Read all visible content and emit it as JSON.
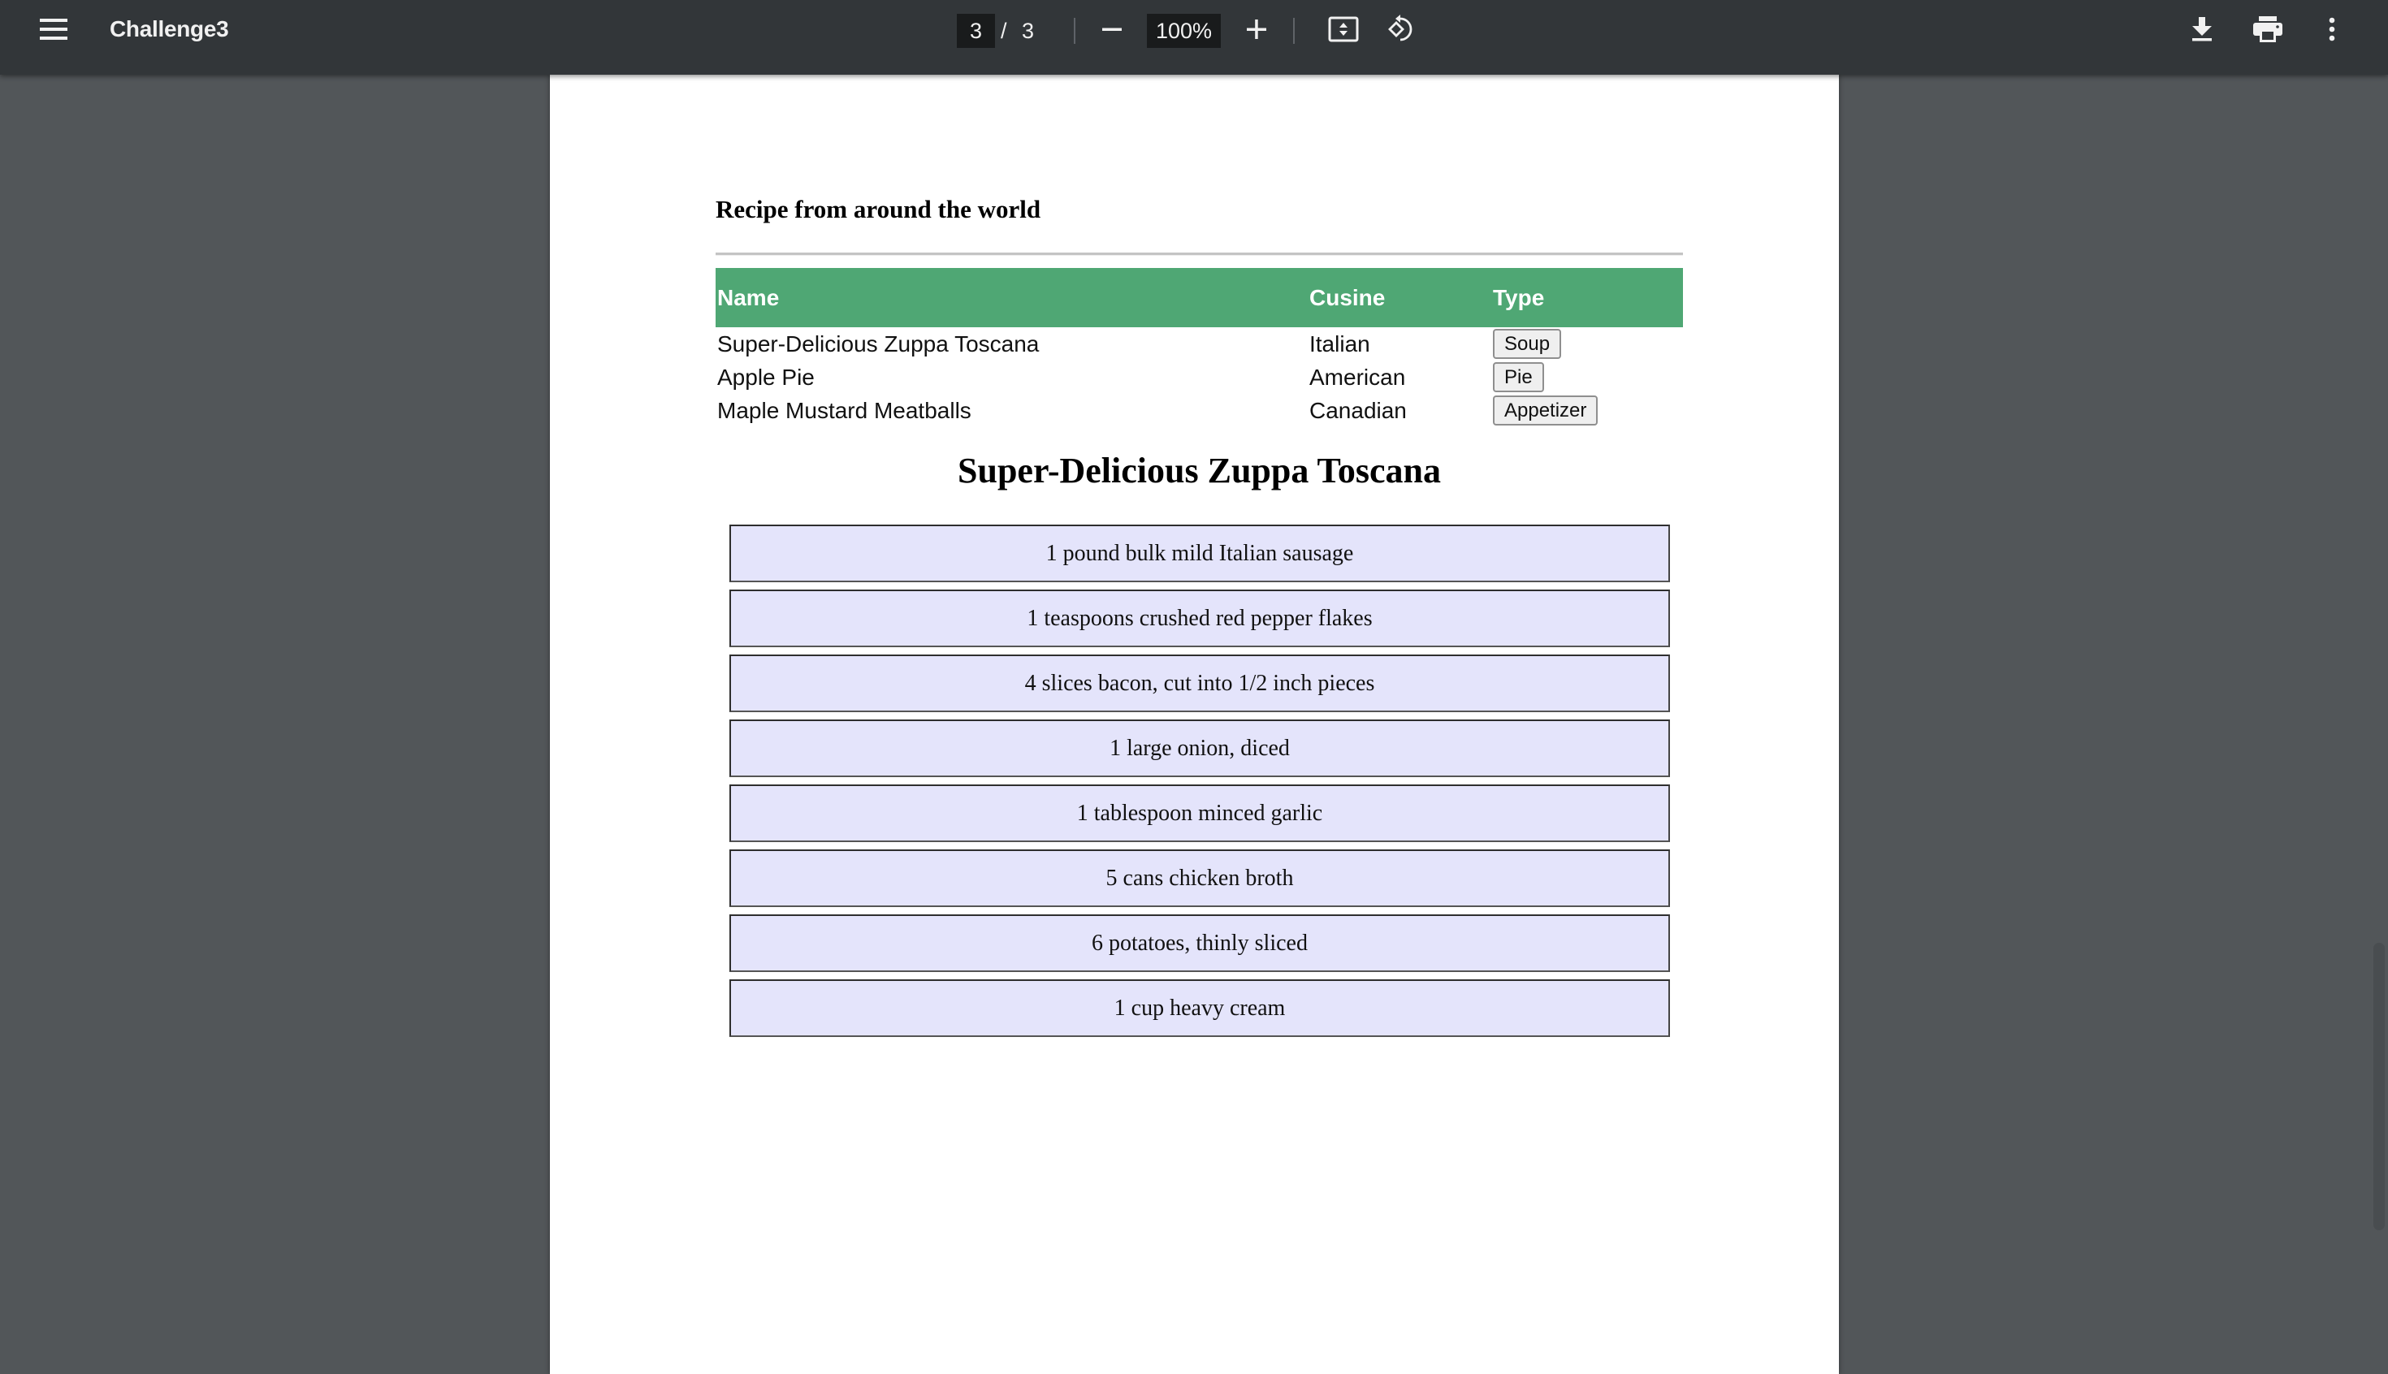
{
  "toolbar": {
    "menu_icon": "hamburger-menu-icon",
    "title": "Challenge3",
    "page_current": "3",
    "page_separator": "/",
    "page_total": "3",
    "zoom_out_icon": "minus-icon",
    "zoom_level": "100%",
    "zoom_in_icon": "plus-icon",
    "fit_icon": "fit-to-page-icon",
    "rotate_icon": "rotate-counterclockwise-icon",
    "download_icon": "download-icon",
    "print_icon": "print-icon",
    "more_icon": "more-vertical-icon"
  },
  "document": {
    "section_title": "Recipe from around the world",
    "table": {
      "headers": [
        "Name",
        "Cusine",
        "Type"
      ],
      "rows": [
        {
          "name": "Super-Delicious Zuppa Toscana",
          "cuisine": "Italian",
          "type": "Soup"
        },
        {
          "name": "Apple Pie",
          "cuisine": "American",
          "type": "Pie"
        },
        {
          "name": "Maple Mustard Meatballs",
          "cuisine": "Canadian",
          "type": "Appetizer"
        }
      ]
    },
    "recipe_title": "Super-Delicious Zuppa Toscana",
    "ingredients": [
      "1 pound bulk mild Italian sausage",
      "1 teaspoons crushed red pepper flakes",
      "4 slices bacon, cut into 1/2 inch pieces",
      "1 large onion, diced",
      "1 tablespoon minced garlic",
      "5 cans chicken broth",
      "6 potatoes, thinly sliced",
      "1 cup heavy cream"
    ]
  },
  "colors": {
    "toolbar_bg": "#323639",
    "viewer_bg": "#525659",
    "table_header_bg": "#4fa774",
    "ingredient_bg": "#e4e4fb"
  }
}
